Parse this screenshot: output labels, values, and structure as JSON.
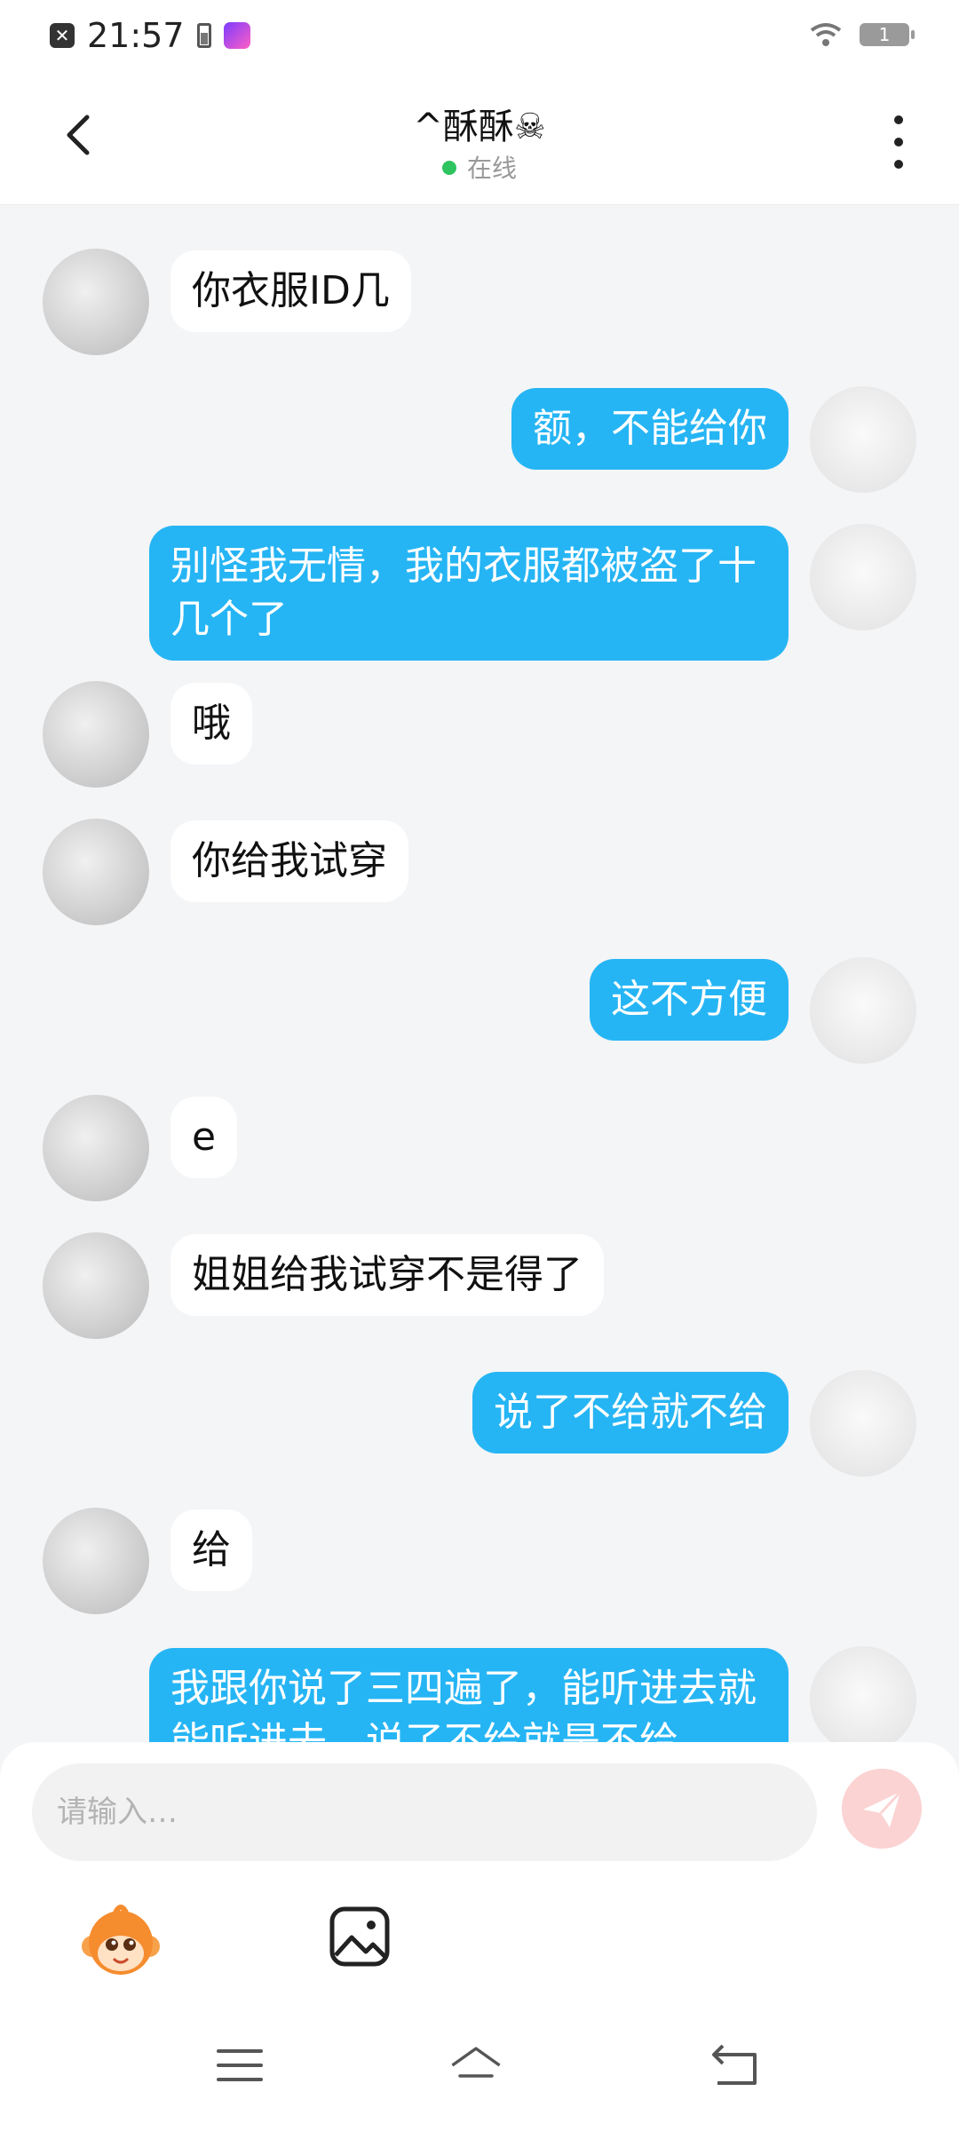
{
  "status_bar": {
    "time": "21:57",
    "battery": "1"
  },
  "header": {
    "title": "^酥酥☠",
    "status": "在线"
  },
  "messages": [
    {
      "side": "left",
      "text": "你衣服ID几"
    },
    {
      "side": "right",
      "text": "额，不能给你"
    },
    {
      "side": "right",
      "text": "别怪我无情，我的衣服都被盗了十几个了"
    },
    {
      "side": "left",
      "text": "哦"
    },
    {
      "side": "left",
      "text": "你给我试穿"
    },
    {
      "side": "right",
      "text": "这不方便"
    },
    {
      "side": "left",
      "text": "e"
    },
    {
      "side": "left",
      "text": "姐姐给我试穿不是得了"
    },
    {
      "side": "right",
      "text": "说了不给就不给"
    },
    {
      "side": "left",
      "text": "给"
    },
    {
      "side": "right",
      "text": "我跟你说了三四遍了，能听进去就能听进去，说了不给就是不给"
    }
  ],
  "input": {
    "placeholder": "请输入…"
  },
  "colors": {
    "my_bubble": "#26b5f4",
    "their_bubble": "#ffffff",
    "online_dot": "#2ec45f",
    "send_button": "#fbd3d3"
  },
  "icons": {
    "back": "chevron-left-icon",
    "more": "more-vertical-icon",
    "send": "send-icon",
    "emoji": "monkey-emoji-icon",
    "image": "image-icon",
    "nav_menu": "menu-icon",
    "nav_home": "home-icon",
    "nav_back": "back-icon"
  }
}
